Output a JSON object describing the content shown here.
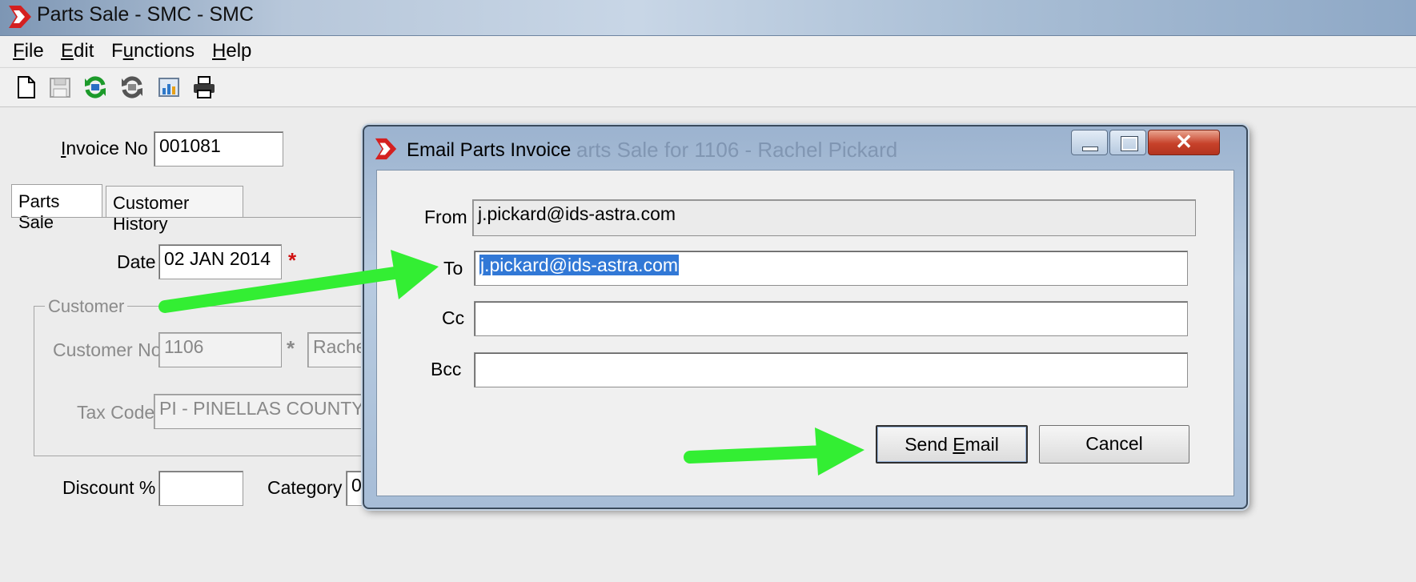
{
  "window": {
    "title": "Parts Sale - SMC - SMC",
    "menu": [
      {
        "accel": "F",
        "rest": "ile"
      },
      {
        "accel": "E",
        "rest": "dit"
      },
      {
        "pre": "F",
        "accel": "u",
        "rest": "nctions"
      },
      {
        "accel": "H",
        "rest": "elp"
      }
    ],
    "toolbar_icons": [
      "new-document-icon",
      "save-icon",
      "refresh-icon",
      "reverse-icon",
      "report-icon",
      "print-icon"
    ]
  },
  "form": {
    "invoice_label_accel": "I",
    "invoice_label_rest": "nvoice No",
    "invoice_no": "001081",
    "tabs": [
      "Parts Sale",
      "Customer History"
    ],
    "date_label": "Date",
    "date_value": "02 JAN 2014",
    "required_mark": "*",
    "customer_group_label": "Customer",
    "customer_no_label": "Customer No",
    "customer_no": "1106",
    "customer_name_partial": "Rache",
    "tax_code_label": "Tax Code",
    "tax_code": "PI - PINELLAS COUNTY",
    "discount_label": "Discount %",
    "discount_value": "",
    "category_label": "Category",
    "category_partial": "0"
  },
  "dialog": {
    "title": "Email Parts Invoice",
    "behind_title_ghost": "arts Sale for 1106 - Rachel Pickard",
    "from_label": "From",
    "from_value": "j.pickard@ids-astra.com",
    "to_label": "To",
    "to_value": "j.pickard@ids-astra.com",
    "cc_label": "Cc",
    "cc_value": "",
    "bcc_label": "Bcc",
    "bcc_value": "",
    "send_pre": "Send ",
    "send_accel": "E",
    "send_rest": "mail",
    "cancel_label": "Cancel"
  },
  "colors": {
    "annotation_arrow": "#33ee33",
    "selection": "#3178d6",
    "required": "#d01010"
  }
}
